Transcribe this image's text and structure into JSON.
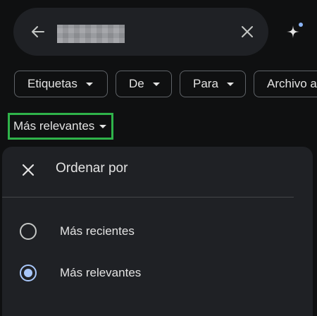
{
  "icons": {
    "back": "arrow-left",
    "clear": "close-x",
    "sparkle": "gemini-sparkle",
    "sheet_close": "close-x"
  },
  "colors": {
    "background": "#0f1011",
    "surface": "#1f2125",
    "chip_border": "#5f6368",
    "highlight": "#2fb34a",
    "radio_selected": "#a8c7fa"
  },
  "filters": {
    "chips": [
      {
        "label": "Etiquetas"
      },
      {
        "label": "De"
      },
      {
        "label": "Para"
      },
      {
        "label": "Archivo a"
      }
    ]
  },
  "sort": {
    "label": "Más relevantes"
  },
  "sheet": {
    "title": "Ordenar por",
    "options": [
      {
        "label": "Más recientes",
        "selected": false
      },
      {
        "label": "Más relevantes",
        "selected": true
      }
    ]
  }
}
